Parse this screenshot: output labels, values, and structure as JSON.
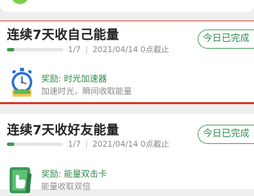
{
  "tasks": [
    {
      "title": "连续7天收自己能量",
      "progress_fraction": 0.14,
      "progress_label": "1/7",
      "deadline": "2021/04/14 0点截止",
      "separator": "|",
      "status": "今日已完成",
      "reward_title": "奖励: 时光加速器",
      "reward_desc": "加速时光，瞬间收取能量",
      "reward_icon": "stopwatch-icon"
    },
    {
      "title": "连续7天收好友能量",
      "progress_fraction": 0.14,
      "progress_label": "1/7",
      "deadline": "2021/04/14 0点截止",
      "separator": "|",
      "status": "今日已完成",
      "reward_title": "奖励: 能量双击卡",
      "reward_desc": "能量收取双倍",
      "reward_icon": "double-hit-card-icon"
    }
  ],
  "colors": {
    "accent_green": "#2e8b4b",
    "highlight_red": "#d9362b",
    "progress_fill": "#3c9a55"
  }
}
